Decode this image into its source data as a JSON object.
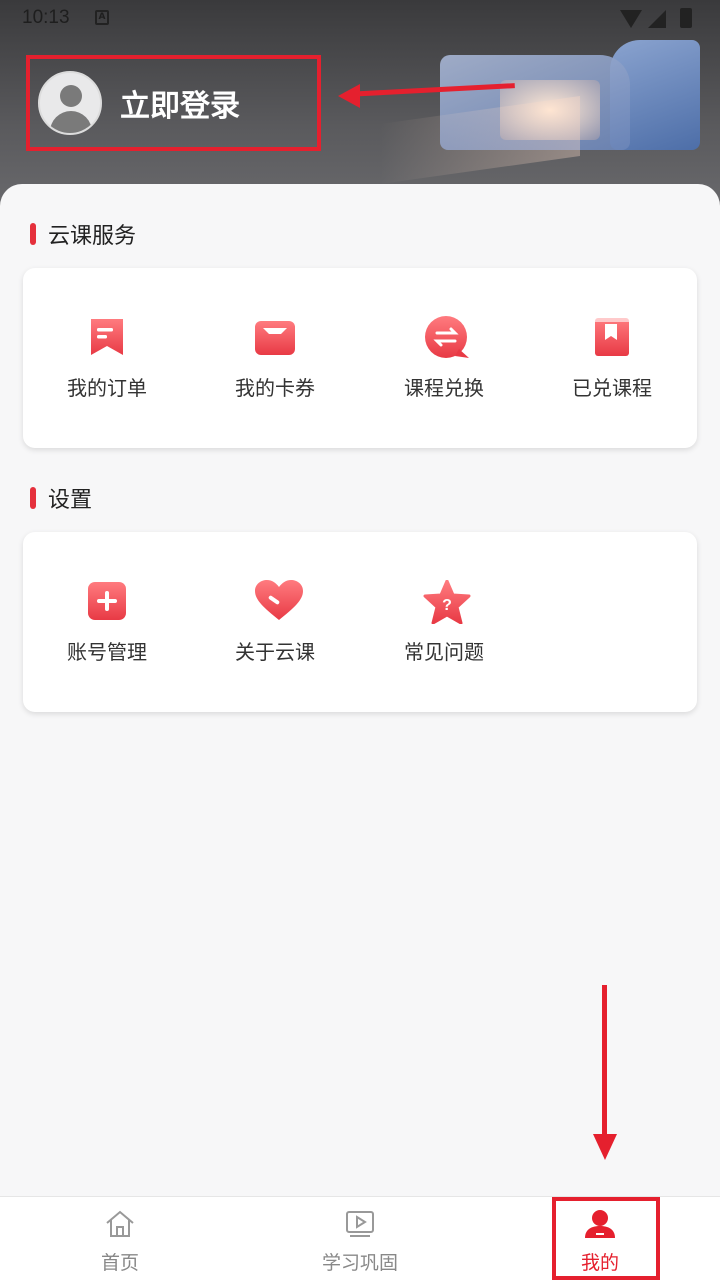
{
  "status_bar": {
    "time": "10:13",
    "a_icon": "A"
  },
  "header": {
    "login_label": "立即登录"
  },
  "sections": {
    "service": {
      "title": "云课服务",
      "items": [
        {
          "label": "我的订单",
          "icon": "order-icon"
        },
        {
          "label": "我的卡券",
          "icon": "coupon-icon"
        },
        {
          "label": "课程兑换",
          "icon": "exchange-icon"
        },
        {
          "label": "已兑课程",
          "icon": "redeemed-course-icon"
        }
      ]
    },
    "settings": {
      "title": "设置",
      "items": [
        {
          "label": "账号管理",
          "icon": "account-icon"
        },
        {
          "label": "关于云课",
          "icon": "heart-icon"
        },
        {
          "label": "常见问题",
          "icon": "faq-star-icon"
        }
      ]
    }
  },
  "tabbar": {
    "items": [
      {
        "label": "首页",
        "icon": "home-icon"
      },
      {
        "label": "学习巩固",
        "icon": "video-icon"
      },
      {
        "label": "我的",
        "icon": "user-icon"
      }
    ]
  },
  "colors": {
    "accent": "#e5202e",
    "icon_gradient_top": "#ff7b7f",
    "icon_gradient_bottom": "#e83a45"
  }
}
